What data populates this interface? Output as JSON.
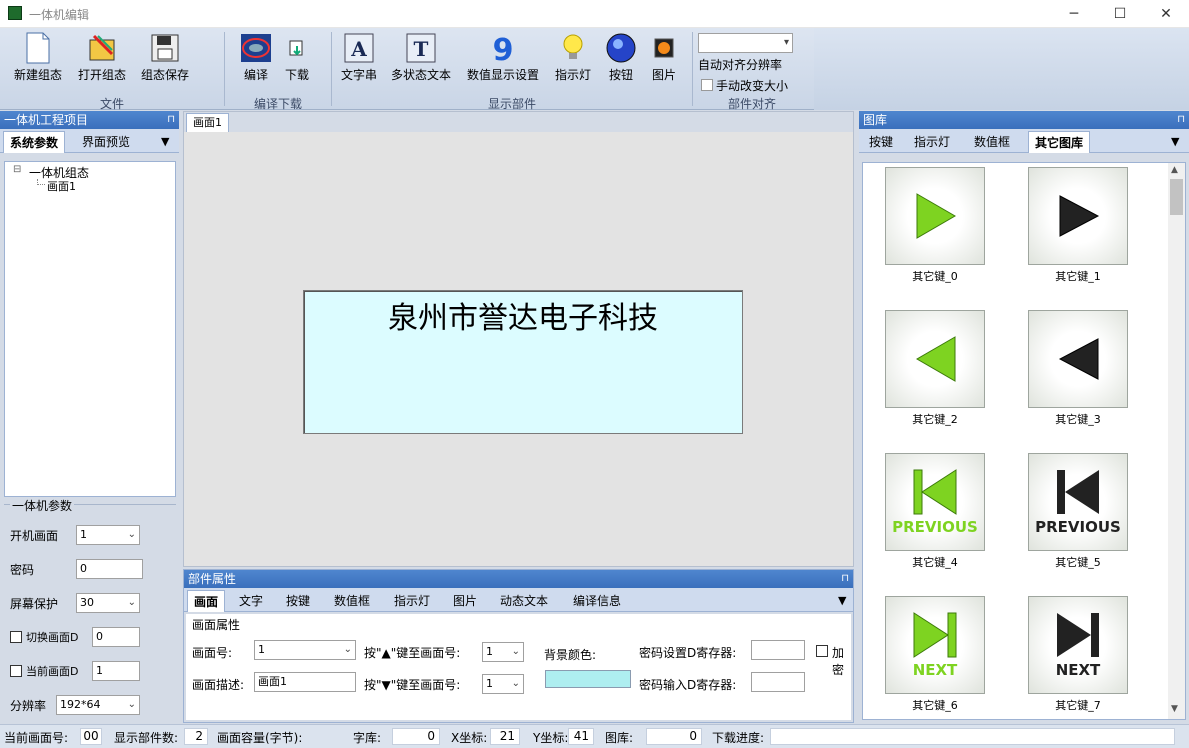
{
  "window": {
    "title": "一体机编辑",
    "min": "─",
    "max": "☐",
    "close": "✕"
  },
  "ribbon": {
    "new": "新建组态",
    "open": "打开组态",
    "save": "组态保存",
    "file_group": "文件",
    "compile": "编译",
    "download": "下载",
    "compile_group": "编译下载",
    "string": "文字串",
    "multitext": "多状态文本",
    "numeric": "数值显示设置",
    "lamp": "指示灯",
    "button": "按钮",
    "picture": "图片",
    "display_group": "显示部件",
    "autoalign": "自动对齐分辨率",
    "manual_resize": "手动改变大小",
    "align_group": "部件对齐"
  },
  "left": {
    "panel_title": "一体机工程项目",
    "tab_sys": "系统参数",
    "tab_preview": "界面预览",
    "tree_root": "一体机组态",
    "tree_child": "画面1",
    "params_title": "一体机参数",
    "boot_label": "开机画面",
    "boot_val": "1",
    "pwd_label": "密码",
    "pwd_val": "0",
    "saver_label": "屏幕保护",
    "saver_val": "30",
    "switch_label": "切换画面D",
    "switch_val": "0",
    "current_label": "当前画面D",
    "current_val": "1",
    "res_label": "分辨率",
    "res_val": "192*64"
  },
  "canvas": {
    "tab": "画面1",
    "text": "泉州市誉达电子科技"
  },
  "props": {
    "panel_title": "部件属性",
    "tabs": [
      "画面",
      "文字",
      "按键",
      "数值框",
      "指示灯",
      "图片",
      "动态文本",
      "编译信息"
    ],
    "section": "画面属性",
    "screen_no_label": "画面号:",
    "screen_no_val": "1",
    "up_label": "按\"▲\"键至画面号:",
    "up_val": "1",
    "bg_label": "背景颜色:",
    "pwdset_label": "密码设置D寄存器:",
    "encrypt_label": "加密",
    "desc_label": "画面描述:",
    "desc_val": "画面1",
    "down_label": "按\"▼\"键至画面号:",
    "down_val": "1",
    "pwdin_label": "密码输入D寄存器:"
  },
  "library": {
    "panel_title": "图库",
    "tabs": [
      "按键",
      "指示灯",
      "数值框",
      "其它图库"
    ],
    "items": [
      "其它键_0",
      "其它键_1",
      "其它键_2",
      "其它键_3",
      "其它键_4",
      "其它键_5",
      "其它键_6",
      "其它键_7"
    ],
    "prev": "PREVIOUS",
    "next": "NEXT"
  },
  "status": {
    "cur_label": "当前画面号:",
    "cur_val": "00",
    "count_label": "显示部件数:",
    "count_val": "2",
    "cap_label": "画面容量(字节):",
    "font_label": "字库:",
    "font_val": "0",
    "x_label": "X坐标:",
    "x_val": "21",
    "y_label": "Y坐标:",
    "y_val": "41",
    "lib_label": "图库:",
    "lib_val": "0",
    "dl_label": "下载进度:"
  },
  "colors": {
    "canvas_bg": "#dcfcff",
    "bg_swatch": "#aeeef0",
    "green": "#7ed321",
    "dark": "#222222"
  }
}
